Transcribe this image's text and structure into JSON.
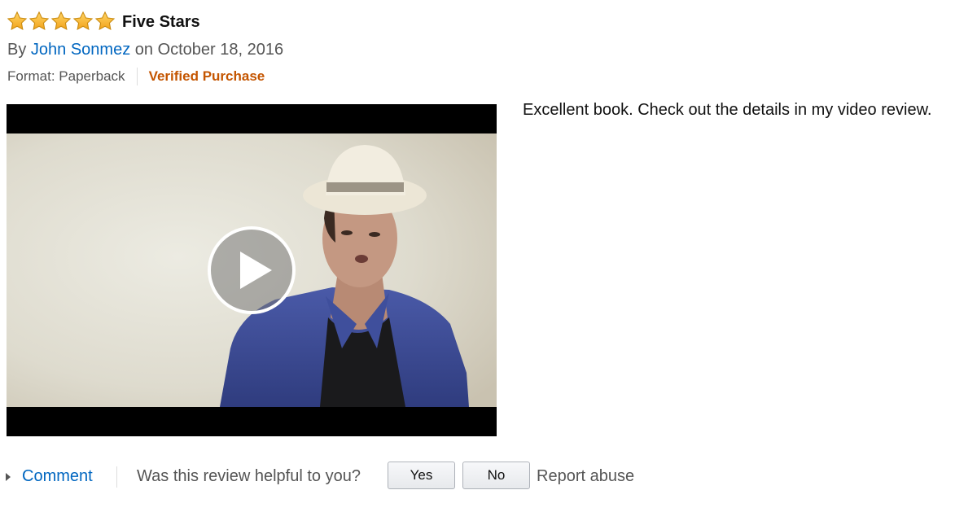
{
  "review": {
    "rating": 5,
    "rating_max": 5,
    "title": "Five Stars",
    "by_label": "By",
    "author": "John Sonmez",
    "date_text": "on October 18, 2016",
    "format_text": "Format: Paperback",
    "verified_label": "Verified Purchase",
    "body": "Excellent book. Check out the details in my video review."
  },
  "video": {
    "play_icon": "play-icon"
  },
  "footer": {
    "comment_label": "Comment",
    "helpful_question": "Was this review helpful to you?",
    "yes_label": "Yes",
    "no_label": "No",
    "report_label": "Report abuse"
  },
  "colors": {
    "link": "#0066c0",
    "verified": "#c45500",
    "star_fill": "#f7b22a",
    "star_stroke": "#c98a0e"
  }
}
